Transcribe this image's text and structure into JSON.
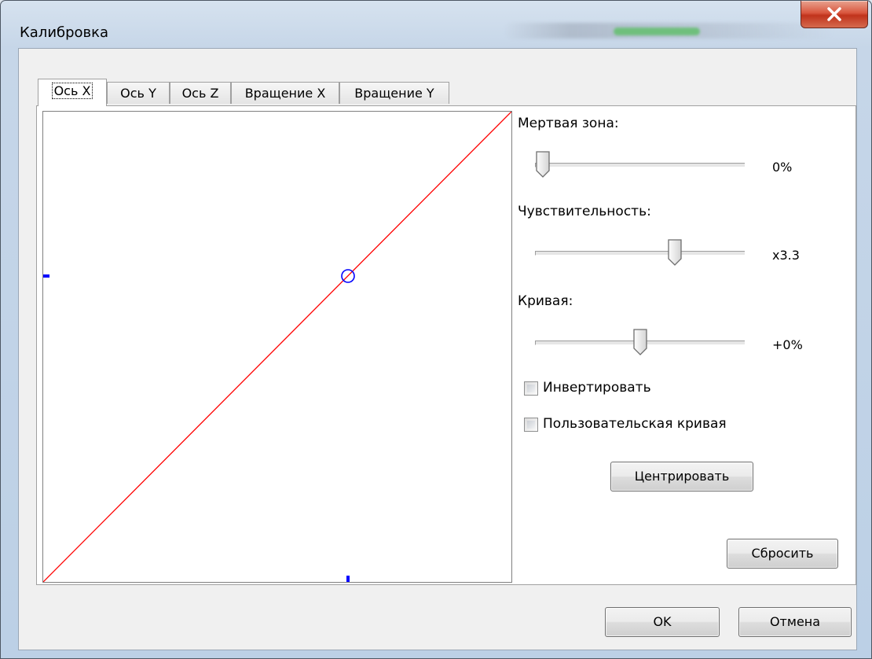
{
  "window": {
    "title": "Калибровка"
  },
  "tabs": [
    {
      "label": "Ось X",
      "active": true
    },
    {
      "label": "Ось Y",
      "active": false
    },
    {
      "label": "Ось Z",
      "active": false
    },
    {
      "label": "Вращение X",
      "active": false
    },
    {
      "label": "Вращение Y",
      "active": false
    }
  ],
  "settings": {
    "dead_zone": {
      "label": "Мертвая зона:",
      "value": "0%",
      "position": 0.0
    },
    "sensitivity": {
      "label": "Чувствительность:",
      "value": "x3.3",
      "position": 0.68
    },
    "curve": {
      "label": "Кривая:",
      "value": "+0%",
      "position": 0.5
    },
    "invert": {
      "label": "Инвертировать",
      "checked": false
    },
    "custom_curve": {
      "label": "Пользовательская кривая",
      "checked": false
    }
  },
  "buttons": {
    "center": "Центрировать",
    "reset": "Сбросить",
    "ok": "OK",
    "cancel": "Отмена"
  },
  "colors": {
    "curve": "#ff0000",
    "marker": "#0000ff"
  },
  "icons": {
    "close": "close-icon"
  }
}
